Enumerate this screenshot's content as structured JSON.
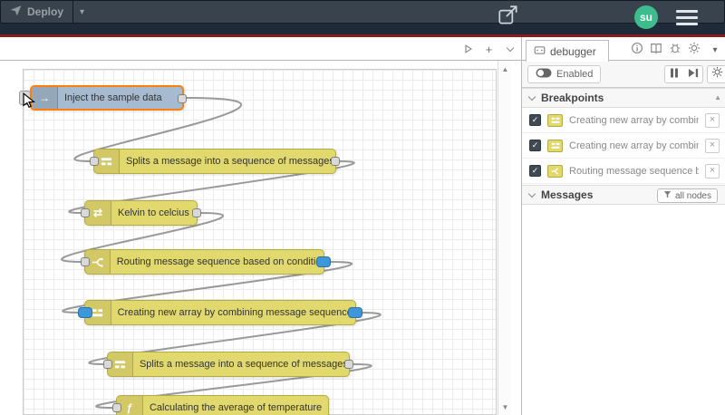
{
  "header": {
    "deploy_label": "Deploy",
    "avatar_text": "su"
  },
  "icons": {
    "close": "×",
    "check": "✓",
    "chevron_down": "▾",
    "plus": "+",
    "scroll_up": "▲",
    "scroll_down": "▼",
    "inject_arrow": "→",
    "change_arrows": "⇄",
    "function_f": "ƒ"
  },
  "canvas": {
    "nodes": [
      {
        "type": "inject",
        "label": "Inject the sample data"
      },
      {
        "type": "split",
        "label": "Splits a message into a sequence of messages."
      },
      {
        "type": "change",
        "label": "Kelvin to celcius"
      },
      {
        "type": "switch",
        "label": "Routing message sequence based on condition"
      },
      {
        "type": "join",
        "label": "Creating new array by combining message sequence"
      },
      {
        "type": "split",
        "label": "Splits a message into a sequence of messages."
      },
      {
        "type": "function",
        "label": "Calculating the average of temperature"
      }
    ]
  },
  "sidebar": {
    "tab_label": "debugger",
    "enabled_label": "Enabled",
    "sections": {
      "breakpoints": "Breakpoints",
      "messages": "Messages"
    },
    "breakpoints": [
      {
        "label": "Creating new array by combining message sequence"
      },
      {
        "label": "Creating new array by combining message sequence"
      },
      {
        "label": "Routing message sequence based on condition"
      }
    ],
    "filter_label": "all nodes"
  },
  "colors": {
    "header_bg": "#1f2b38",
    "deploy_line_red": "#8b1a1a",
    "accent_orange": "#ff7f0e",
    "node_yellow": "#e2d96e",
    "inject_gray_blue": "#a6bbcf",
    "breakpoint_blue": "#3d97d8",
    "avatar_green": "#3dbd8d",
    "wire_gray": "#999999"
  }
}
